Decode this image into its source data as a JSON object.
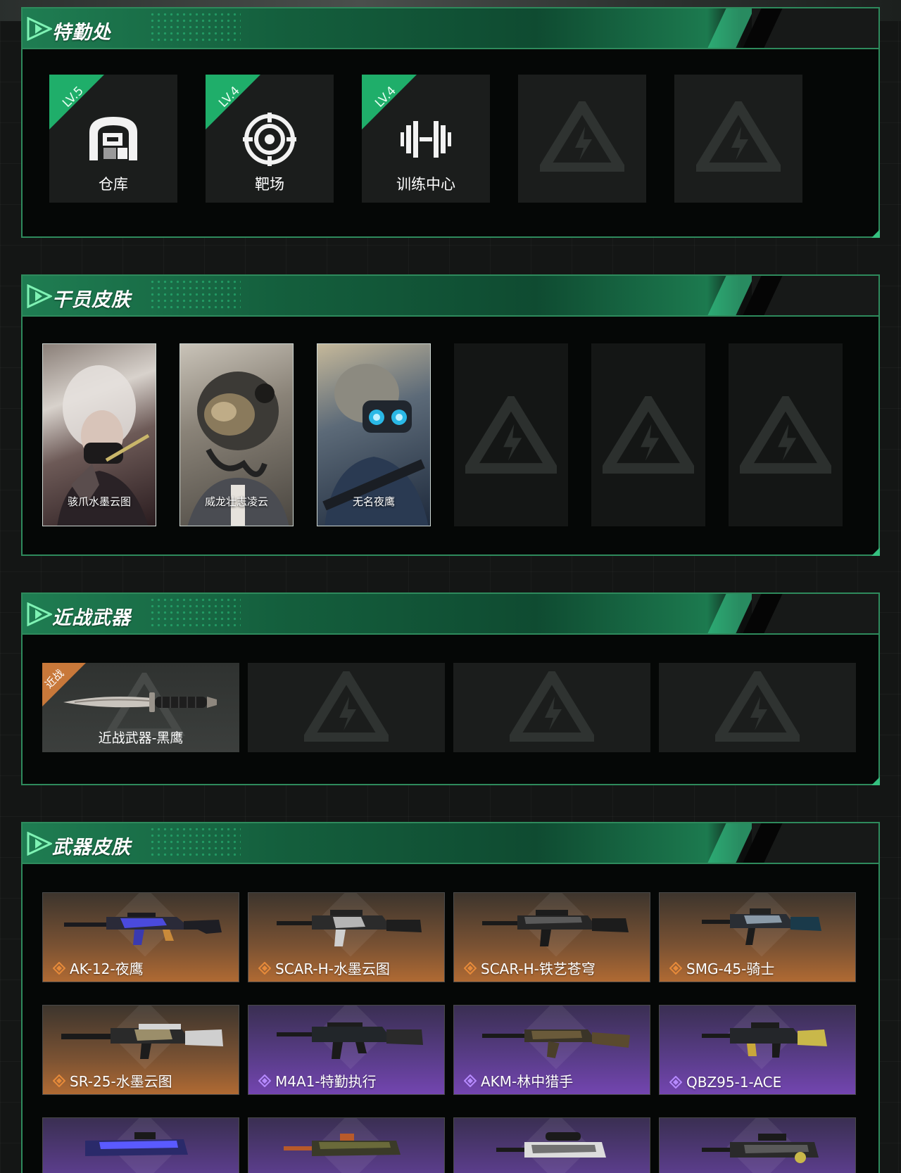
{
  "sections": {
    "facility": {
      "title": "特勤处",
      "items": [
        {
          "level": "LV.5",
          "label": "仓库",
          "icon": "warehouse-icon"
        },
        {
          "level": "LV.4",
          "label": "靶场",
          "icon": "target-icon"
        },
        {
          "level": "LV.4",
          "label": "训练中心",
          "icon": "dumbbell-icon"
        }
      ]
    },
    "operator_skins": {
      "title": "干员皮肤",
      "items": [
        {
          "label": "骇爪水墨云图"
        },
        {
          "label": "威龙壮志凌云"
        },
        {
          "label": "无名夜鹰"
        }
      ]
    },
    "melee": {
      "title": "近战武器",
      "items": [
        {
          "tag": "近战",
          "label": "近战武器-黑鹰"
        }
      ]
    },
    "weapon_skins": {
      "title": "武器皮肤",
      "items": [
        {
          "label": "AK-12-夜鹰",
          "rarity": "orange"
        },
        {
          "label": "SCAR-H-水墨云图",
          "rarity": "orange"
        },
        {
          "label": "SCAR-H-铁艺苍穹",
          "rarity": "orange"
        },
        {
          "label": "SMG-45-骑士",
          "rarity": "orange"
        },
        {
          "label": "SR-25-水墨云图",
          "rarity": "orange"
        },
        {
          "label": "M4A1-特勤执行",
          "rarity": "purple"
        },
        {
          "label": "AKM-林中猎手",
          "rarity": "purple"
        },
        {
          "label": "QBZ95-1-ACE",
          "rarity": "purple"
        }
      ]
    }
  },
  "colors": {
    "accent_green": "#1fae6a",
    "border_green": "#2e8a5c",
    "rarity_orange": "#b06a33",
    "rarity_purple": "#7345b0"
  }
}
